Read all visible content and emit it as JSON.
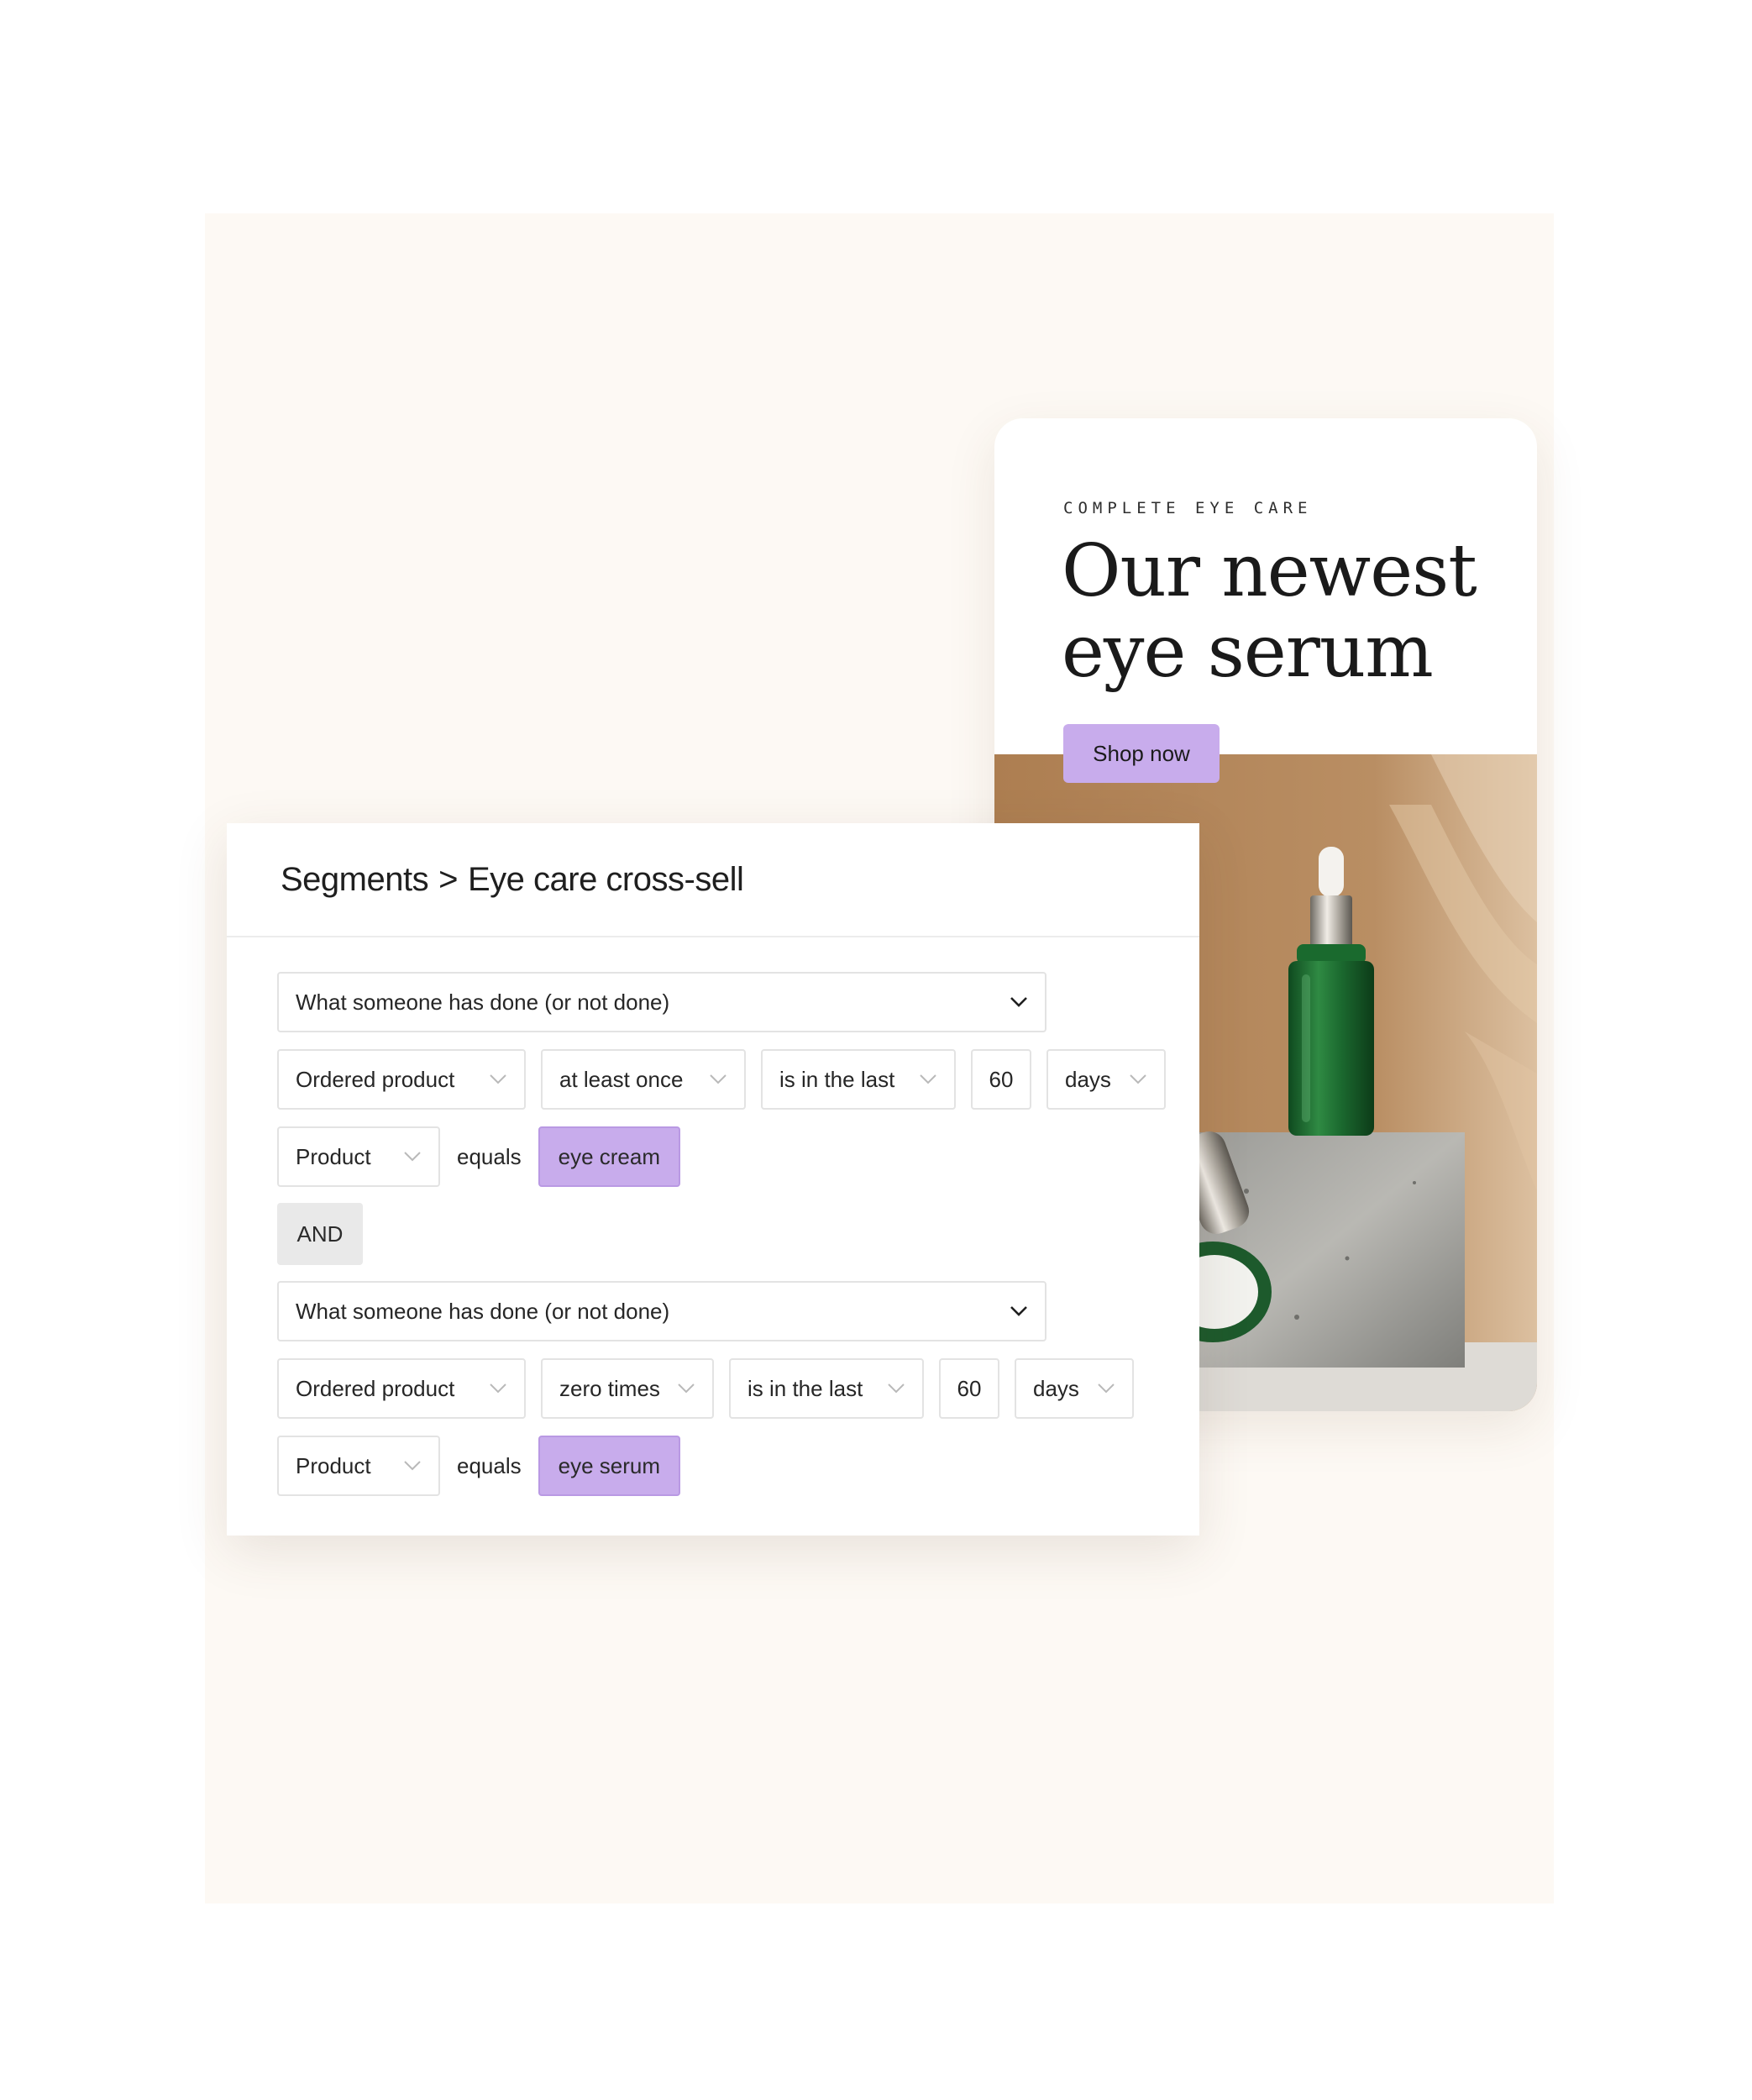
{
  "promo": {
    "eyebrow": "COMPLETE EYE CARE",
    "headline_line1": "Our newest",
    "headline_line2": "eye serum",
    "cta_label": "Shop now",
    "accent_color": "#c8acec"
  },
  "panel": {
    "breadcrumb_root": "Segments",
    "breadcrumb_sep": ">",
    "breadcrumb_current": "Eye care cross-sell",
    "and_label": "AND",
    "groups": [
      {
        "condition": "What someone has done (or not done)",
        "action": "Ordered product",
        "frequency": "at least once",
        "timeframe": "is in the last",
        "amount": "60",
        "unit": "days",
        "property": "Product",
        "operator": "equals",
        "value": "eye cream"
      },
      {
        "condition": "What someone has done (or not done)",
        "action": "Ordered product",
        "frequency": "zero times",
        "timeframe": "is in the last",
        "amount": "60",
        "unit": "days",
        "property": "Product",
        "operator": "equals",
        "value": "eye serum"
      }
    ]
  },
  "icons": {
    "dropdown": "chevron-down-icon",
    "photo": "serum-bottle-image"
  }
}
